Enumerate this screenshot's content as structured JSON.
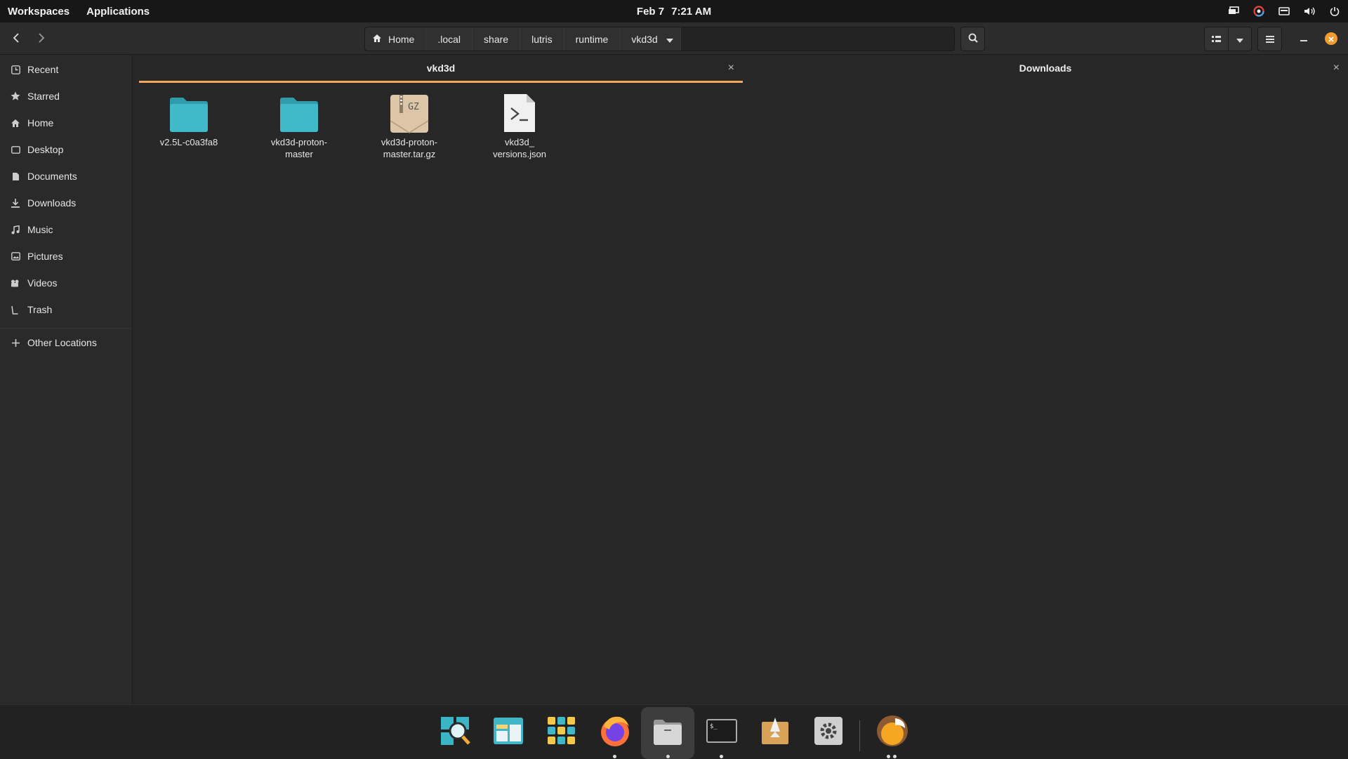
{
  "topbar": {
    "workspaces": "Workspaces",
    "applications": "Applications",
    "date": "Feb 7",
    "time": "7:21 AM"
  },
  "pathbar": {
    "crumbs": [
      "Home",
      ".local",
      "share",
      "lutris",
      "runtime",
      "vkd3d"
    ]
  },
  "sidebar": {
    "items": [
      {
        "label": "Recent",
        "icon": "clock-icon"
      },
      {
        "label": "Starred",
        "icon": "star-icon"
      },
      {
        "label": "Home",
        "icon": "home-icon"
      },
      {
        "label": "Desktop",
        "icon": "desktop-icon"
      },
      {
        "label": "Documents",
        "icon": "document-icon"
      },
      {
        "label": "Downloads",
        "icon": "download-icon"
      },
      {
        "label": "Music",
        "icon": "music-icon"
      },
      {
        "label": "Pictures",
        "icon": "picture-icon"
      },
      {
        "label": "Videos",
        "icon": "video-icon"
      },
      {
        "label": "Trash",
        "icon": "trash-icon"
      }
    ],
    "other_locations": "Other Locations"
  },
  "tabs": [
    {
      "label": "vkd3d",
      "active": true
    },
    {
      "label": "Downloads",
      "active": false
    }
  ],
  "files": [
    {
      "name": "v2.5L-c0a3fa8",
      "type": "folder"
    },
    {
      "name": "vkd3d-proton-\nmaster",
      "type": "folder"
    },
    {
      "name": "vkd3d-proton-\nmaster.tar.gz",
      "type": "archive",
      "badge": "GZ"
    },
    {
      "name": "vkd3d_\nversions.json",
      "type": "script"
    }
  ],
  "dock": {
    "apps": [
      "search-app",
      "files-viewer-app",
      "app-grid",
      "firefox",
      "files",
      "terminal",
      "app-store",
      "settings",
      "lutris"
    ]
  },
  "colors": {
    "accent": "#f0a95c",
    "folder": "#3fb8c7",
    "close_button": "#f39b2f"
  }
}
